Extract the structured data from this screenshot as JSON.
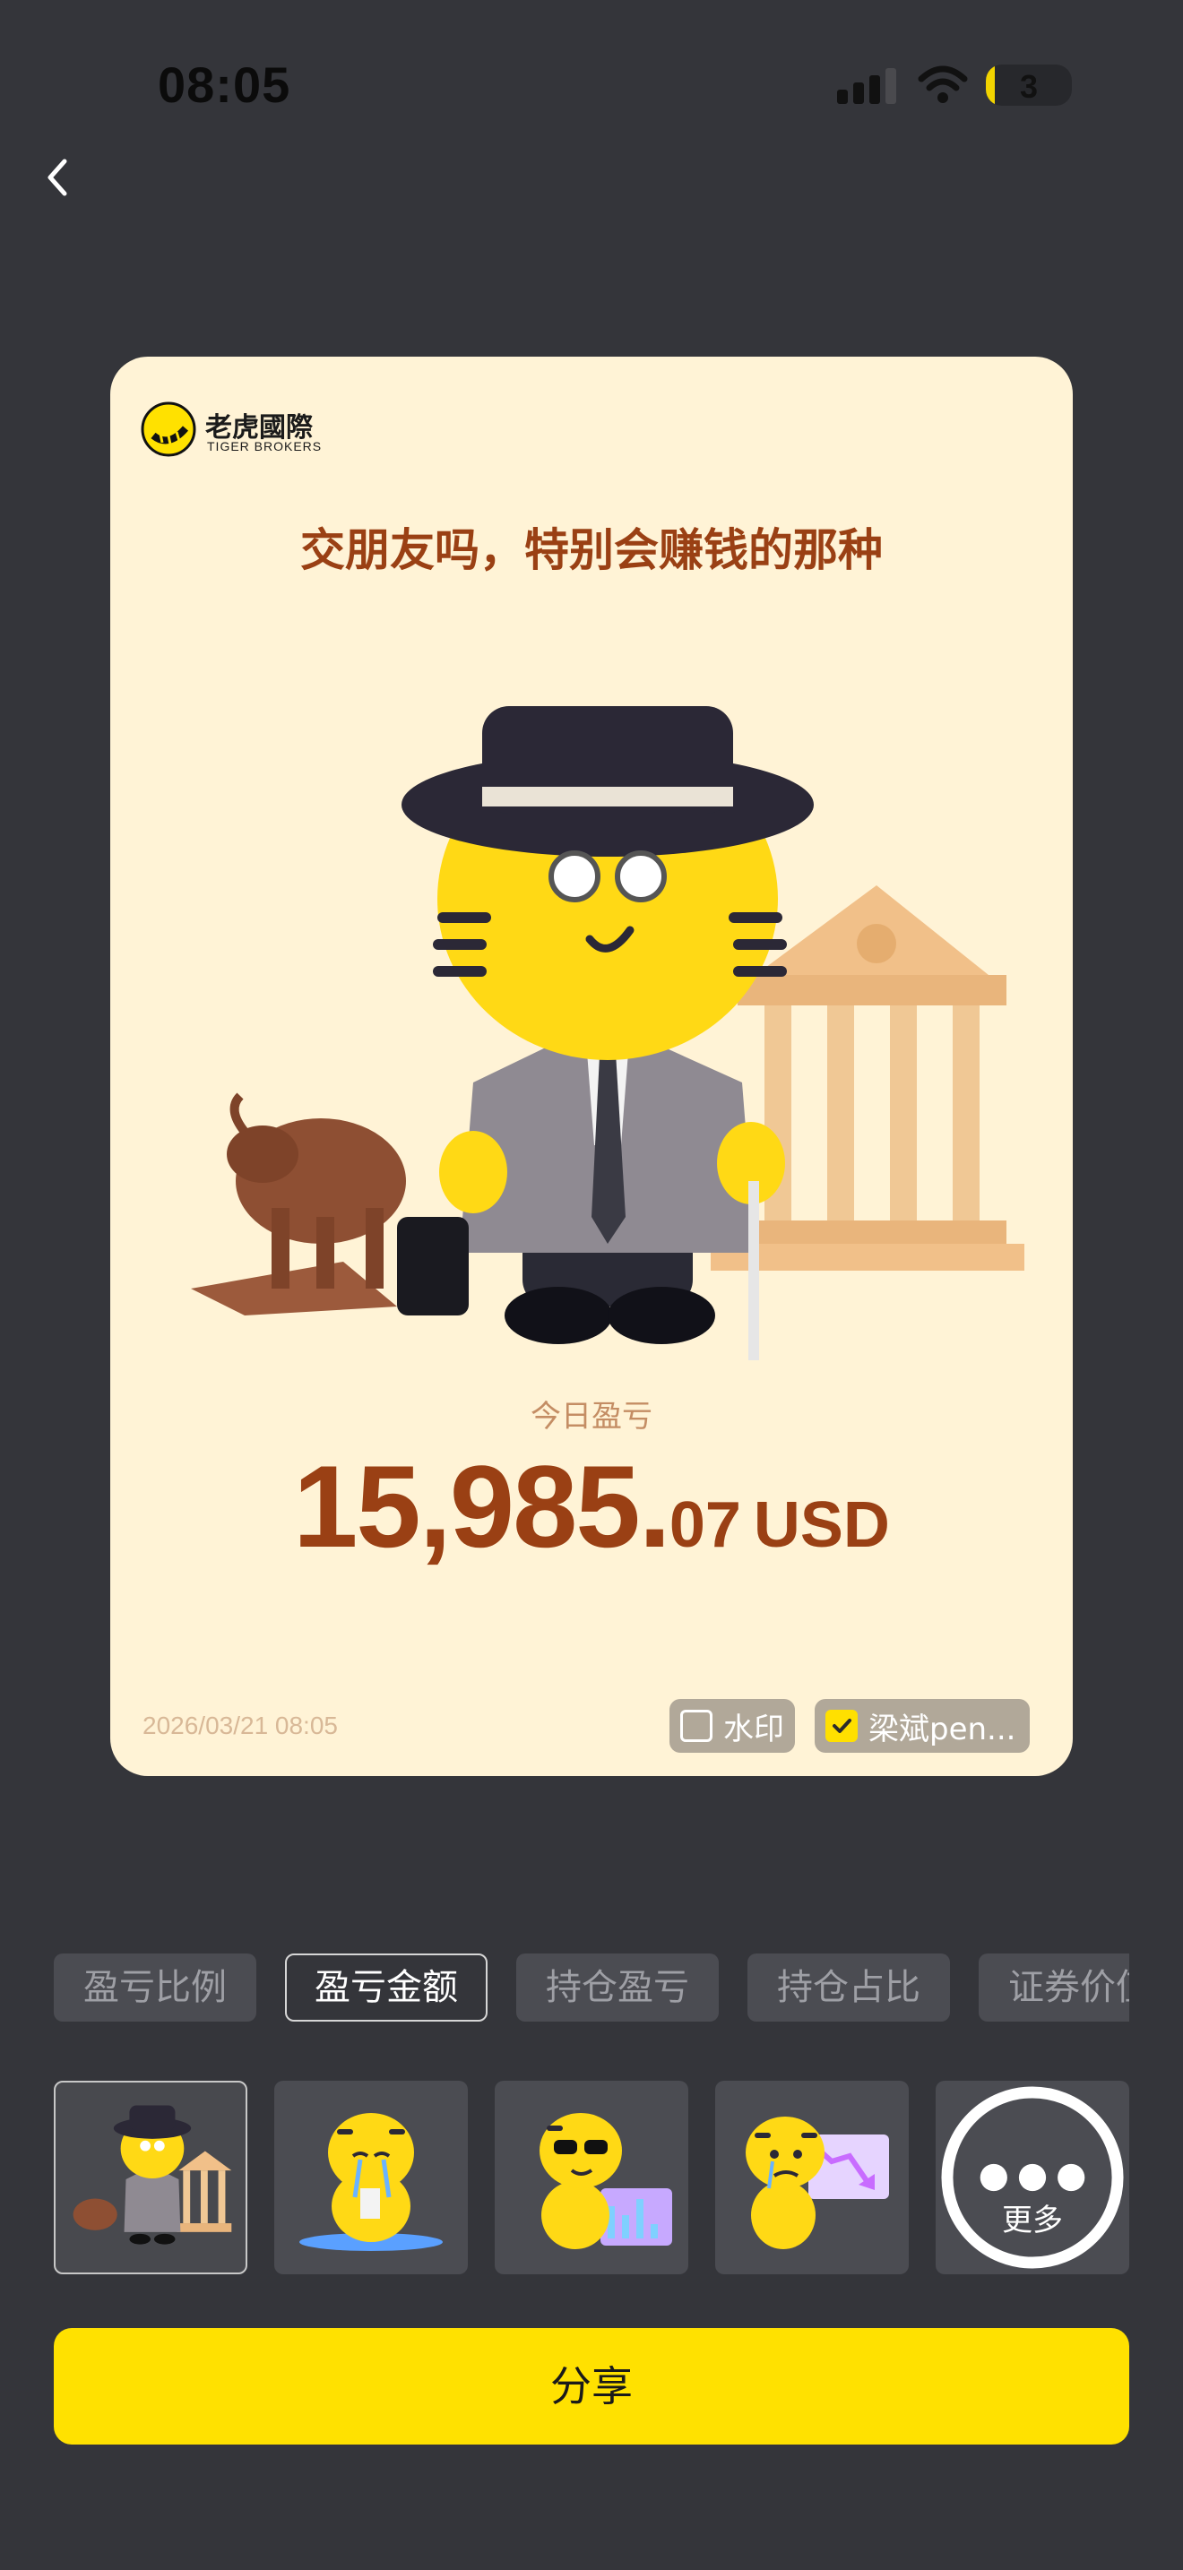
{
  "status_bar": {
    "time": "08:05",
    "battery": "3",
    "battery_level": 0.1
  },
  "header": {
    "back_icon": "chevron-left-icon"
  },
  "card": {
    "logo": {
      "name_cn": "老虎國際",
      "name_en": "TIGER BROKERS"
    },
    "headline": "交朋友吗，特别会赚钱的那种",
    "pnl_label": "今日盈亏",
    "pnl_integer": "15,985.",
    "pnl_decimal": "07",
    "pnl_currency": "USD",
    "date": "2026/03/21 08:05",
    "watermark": {
      "label": "水印",
      "checked": false
    },
    "name": {
      "label": "梁斌pen...",
      "checked": true
    }
  },
  "tabs": [
    "盈亏比例",
    "盈亏金额",
    "持仓盈亏",
    "持仓占比",
    "证券价值"
  ],
  "active_tab": 1,
  "thumbnails": {
    "items": [
      "tiger-gentleman",
      "tiger-crying",
      "tiger-sunglasses-chart",
      "tiger-falling-chart"
    ],
    "selected": 0,
    "more_label": "更多"
  },
  "share_label": "分享",
  "colors": {
    "accent": "#ffe100",
    "card_bg": "#fff3d6",
    "headline": "#9a4014",
    "background": "#34353a"
  }
}
